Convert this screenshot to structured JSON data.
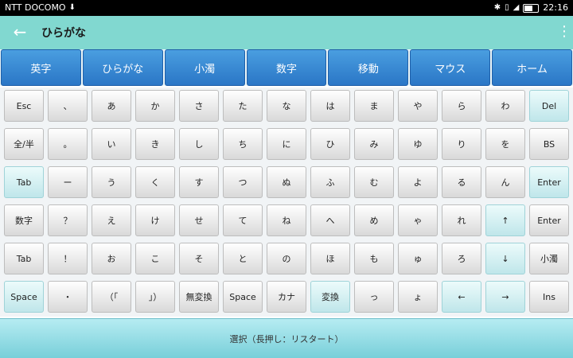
{
  "status_bar": {
    "carrier": "NTT DOCOMO",
    "time": "22:16"
  },
  "app_bar": {
    "title": "ひらがな",
    "back_icon": "arrow-left-icon",
    "menu_icon": "more-vert-icon"
  },
  "tabs": [
    {
      "label": "英字"
    },
    {
      "label": "ひらがな"
    },
    {
      "label": "小濁"
    },
    {
      "label": "数字"
    },
    {
      "label": "移動"
    },
    {
      "label": "マウス"
    },
    {
      "label": "ホーム"
    }
  ],
  "keyboard": {
    "rows": [
      [
        {
          "label": "Esc"
        },
        {
          "label": "、"
        },
        {
          "label": "あ"
        },
        {
          "label": "か"
        },
        {
          "label": "さ"
        },
        {
          "label": "た"
        },
        {
          "label": "な"
        },
        {
          "label": "は"
        },
        {
          "label": "ま"
        },
        {
          "label": "や"
        },
        {
          "label": "ら"
        },
        {
          "label": "わ"
        },
        {
          "label": "Del",
          "style": "cyan"
        }
      ],
      [
        {
          "label": "全/半"
        },
        {
          "label": "。"
        },
        {
          "label": "い"
        },
        {
          "label": "き"
        },
        {
          "label": "し"
        },
        {
          "label": "ち"
        },
        {
          "label": "に"
        },
        {
          "label": "ひ"
        },
        {
          "label": "み"
        },
        {
          "label": "ゆ"
        },
        {
          "label": "り"
        },
        {
          "label": "を"
        },
        {
          "label": "BS"
        }
      ],
      [
        {
          "label": "Tab",
          "style": "cyan"
        },
        {
          "label": "ー"
        },
        {
          "label": "う"
        },
        {
          "label": "く"
        },
        {
          "label": "す"
        },
        {
          "label": "つ"
        },
        {
          "label": "ぬ"
        },
        {
          "label": "ふ"
        },
        {
          "label": "む"
        },
        {
          "label": "よ"
        },
        {
          "label": "る"
        },
        {
          "label": "ん"
        },
        {
          "label": "Enter",
          "style": "cyan"
        }
      ],
      [
        {
          "label": "数字"
        },
        {
          "label": "？"
        },
        {
          "label": "え"
        },
        {
          "label": "け"
        },
        {
          "label": "せ"
        },
        {
          "label": "て"
        },
        {
          "label": "ね"
        },
        {
          "label": "へ"
        },
        {
          "label": "め"
        },
        {
          "label": "ゃ"
        },
        {
          "label": "れ"
        },
        {
          "label": "↑",
          "style": "cyan"
        },
        {
          "label": "Enter"
        }
      ],
      [
        {
          "label": "Tab"
        },
        {
          "label": "！"
        },
        {
          "label": "お"
        },
        {
          "label": "こ"
        },
        {
          "label": "そ"
        },
        {
          "label": "と"
        },
        {
          "label": "の"
        },
        {
          "label": "ほ"
        },
        {
          "label": "も"
        },
        {
          "label": "ゅ"
        },
        {
          "label": "ろ"
        },
        {
          "label": "↓",
          "style": "cyan"
        },
        {
          "label": "小濁"
        }
      ],
      [
        {
          "label": "Space",
          "style": "cyan"
        },
        {
          "label": "・"
        },
        {
          "label": "（「"
        },
        {
          "label": "」）"
        },
        {
          "label": "無変換"
        },
        {
          "label": "Space"
        },
        {
          "label": "カナ"
        },
        {
          "label": "変換",
          "style": "cyan"
        },
        {
          "label": "っ"
        },
        {
          "label": "ょ"
        },
        {
          "label": "←",
          "style": "cyan"
        },
        {
          "label": "→",
          "style": "cyan"
        },
        {
          "label": "Ins"
        }
      ]
    ]
  },
  "bottom_bar": {
    "label": "選択（長押し：リスタート）"
  }
}
